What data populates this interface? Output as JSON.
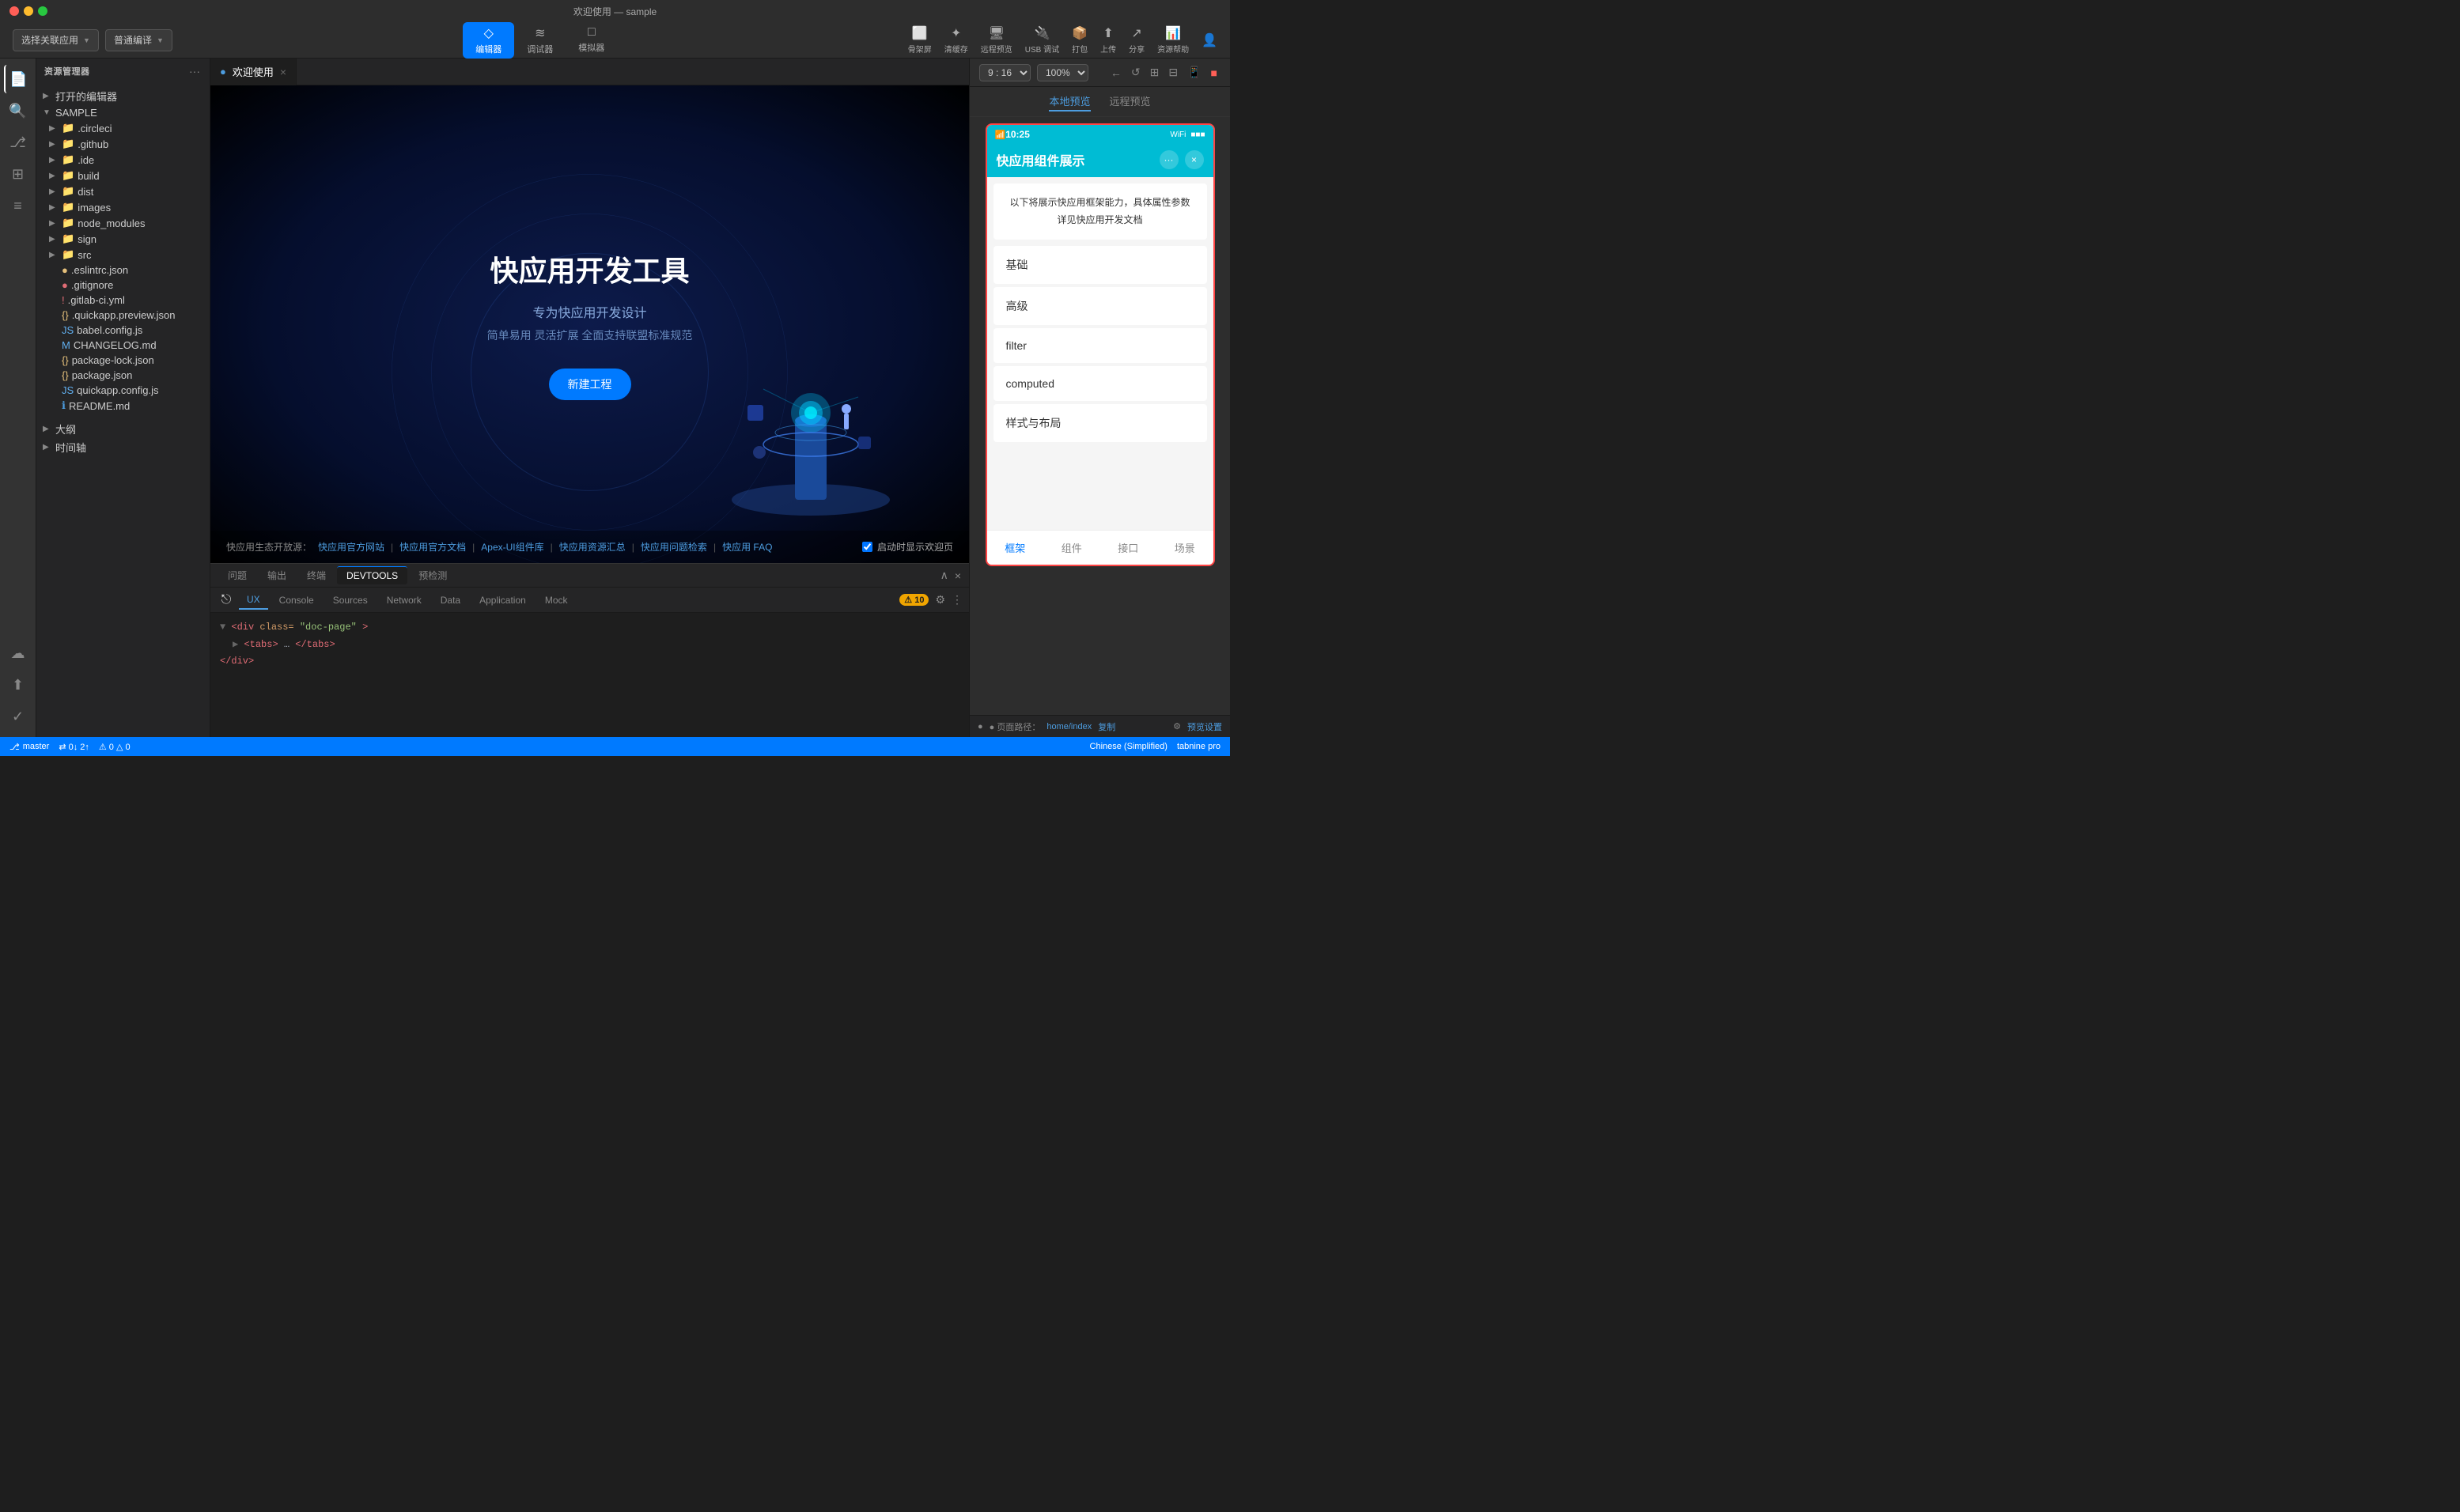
{
  "titlebar": {
    "title": "欢迎使用 — sample"
  },
  "toolbar": {
    "left": {
      "associate_app": "选择关联应用",
      "compile_mode": "普通编译"
    },
    "center": {
      "tabs": [
        {
          "id": "editor",
          "label": "编辑器",
          "icon": "◇",
          "active": true
        },
        {
          "id": "debug",
          "label": "调试器",
          "icon": "≋",
          "active": false
        },
        {
          "id": "simulator",
          "label": "模拟器",
          "icon": "□",
          "active": false
        }
      ]
    },
    "right": {
      "actions": [
        {
          "id": "skeleton",
          "label": "骨架屏",
          "icon": "⬜"
        },
        {
          "id": "clear-cache",
          "label": "清缓存",
          "icon": "✦"
        },
        {
          "id": "remote-preview",
          "label": "远程预览",
          "icon": "🖥"
        },
        {
          "id": "usb-debug",
          "label": "USB 调试",
          "icon": "🔌"
        },
        {
          "id": "package",
          "label": "打包",
          "icon": "📦"
        },
        {
          "id": "upload",
          "label": "上传",
          "icon": "⬆"
        },
        {
          "id": "share",
          "label": "分享",
          "icon": "↗"
        },
        {
          "id": "docs-help",
          "label": "资源帮助",
          "icon": "📊"
        },
        {
          "id": "account",
          "label": "账号",
          "icon": "👤"
        }
      ]
    }
  },
  "sidebar": {
    "title": "资源管理器",
    "sections": [
      {
        "label": "打开的编辑器",
        "expanded": false
      },
      {
        "label": "SAMPLE",
        "expanded": true,
        "items": [
          {
            "type": "folder",
            "name": ".circleci",
            "indent": 1,
            "expanded": false
          },
          {
            "type": "folder",
            "name": ".github",
            "indent": 1,
            "expanded": false
          },
          {
            "type": "folder",
            "name": ".ide",
            "indent": 1,
            "expanded": false
          },
          {
            "type": "folder",
            "name": "build",
            "indent": 1,
            "expanded": false
          },
          {
            "type": "folder",
            "name": "dist",
            "indent": 1,
            "expanded": false
          },
          {
            "type": "folder",
            "name": "images",
            "indent": 1,
            "expanded": false
          },
          {
            "type": "folder",
            "name": "node_modules",
            "indent": 1,
            "expanded": false
          },
          {
            "type": "folder",
            "name": "sign",
            "indent": 1,
            "expanded": false
          },
          {
            "type": "folder",
            "name": "src",
            "indent": 1,
            "expanded": false
          },
          {
            "type": "file",
            "name": ".eslintrc.json",
            "indent": 1,
            "color": "yellow",
            "dot": "●"
          },
          {
            "type": "file",
            "name": ".gitignore",
            "indent": 1,
            "color": "red",
            "dot": "●"
          },
          {
            "type": "file",
            "name": ".gitlab-ci.yml",
            "indent": 1,
            "color": "red",
            "dot": "!"
          },
          {
            "type": "file",
            "name": ".quickapp.preview.json",
            "indent": 1,
            "color": "yellow",
            "dot": "{}"
          },
          {
            "type": "file",
            "name": "babel.config.js",
            "indent": 1,
            "color": "blue",
            "dot": "JS"
          },
          {
            "type": "file",
            "name": "CHANGELOG.md",
            "indent": 1,
            "color": "blue",
            "dot": "M"
          },
          {
            "type": "file",
            "name": "package-lock.json",
            "indent": 1,
            "color": "yellow",
            "dot": "{}"
          },
          {
            "type": "file",
            "name": "package.json",
            "indent": 1,
            "color": "yellow",
            "dot": "{}"
          },
          {
            "type": "file",
            "name": "quickapp.config.js",
            "indent": 1,
            "color": "blue",
            "dot": "JS"
          },
          {
            "type": "file",
            "name": "README.md",
            "indent": 1,
            "color": "blue",
            "dot": "ℹ"
          }
        ]
      }
    ],
    "bottom": [
      {
        "label": "大纲",
        "expanded": false
      },
      {
        "label": "时间轴",
        "expanded": false
      }
    ]
  },
  "icon_bar": {
    "items": [
      {
        "id": "explorer",
        "icon": "📄",
        "active": true
      },
      {
        "id": "search",
        "icon": "🔍",
        "active": false
      },
      {
        "id": "git",
        "icon": "⎇",
        "active": false
      },
      {
        "id": "extensions",
        "icon": "⊞",
        "active": false
      },
      {
        "id": "layers",
        "icon": "≡",
        "active": false
      },
      {
        "id": "cloud",
        "icon": "☁",
        "active": false
      },
      {
        "id": "deploy",
        "icon": "⬆",
        "active": false
      },
      {
        "id": "check",
        "icon": "✓",
        "active": false
      }
    ]
  },
  "welcome": {
    "title": "快应用开发工具",
    "subtitle": "专为快应用开发设计",
    "desc": "简单易用 灵活扩展 全面支持联盟标准规范",
    "new_project_btn": "新建工程",
    "links": [
      {
        "label": "快应用生态开放源：",
        "type": "text"
      },
      {
        "label": "快应用官方网站",
        "type": "link"
      },
      {
        "label": "快应用官方文档",
        "type": "link"
      },
      {
        "label": "Apex-UI组件库",
        "type": "link"
      },
      {
        "label": "快应用资源汇总",
        "type": "link"
      },
      {
        "label": "快应用问题检索",
        "type": "link"
      },
      {
        "label": "快应用 FAQ",
        "type": "link"
      }
    ],
    "show_on_startup": "启动时显示欢迎页"
  },
  "editor_tab": {
    "label": "欢迎使用",
    "close": "×"
  },
  "panel_tabs": [
    {
      "id": "problems",
      "label": "问题"
    },
    {
      "id": "output",
      "label": "输出"
    },
    {
      "id": "terminal",
      "label": "终端"
    },
    {
      "id": "devtools",
      "label": "DEVTOOLS",
      "active": true
    },
    {
      "id": "precheck",
      "label": "预检测"
    }
  ],
  "devtools": {
    "tabs": [
      {
        "id": "ux",
        "label": "UX",
        "active": true
      },
      {
        "id": "console",
        "label": "Console"
      },
      {
        "id": "sources",
        "label": "Sources"
      },
      {
        "id": "network",
        "label": "Network"
      },
      {
        "id": "data",
        "label": "Data"
      },
      {
        "id": "application",
        "label": "Application"
      },
      {
        "id": "mock",
        "label": "Mock"
      }
    ],
    "code": [
      {
        "line": "▼ <div class=\"doc-page\">"
      },
      {
        "line": "  ▶ <tabs>…</tabs>"
      },
      {
        "line": "  </div>"
      }
    ],
    "warning_count": "⚠ 10"
  },
  "right_panel": {
    "preview_ratio": "9 : 16",
    "zoom": "100%",
    "local_remote_tabs": [
      {
        "id": "local",
        "label": "本地预览",
        "active": true
      },
      {
        "id": "remote",
        "label": "远程预览",
        "active": false
      }
    ],
    "phone": {
      "status_bar": {
        "signal": "📶",
        "time": "10:25",
        "wifi": "WiFi",
        "battery": "■■■"
      },
      "app_title": "快应用组件展示",
      "desc_line1": "以下将展示快应用框架能力，具体属性参数",
      "desc_line2": "详见快应用开发文档",
      "menu_items": [
        {
          "label": "基础"
        },
        {
          "label": "高级"
        },
        {
          "label": "filter"
        },
        {
          "label": "computed"
        },
        {
          "label": "样式与布局"
        }
      ],
      "bottom_tabs": [
        {
          "id": "framework",
          "label": "框架",
          "active": true
        },
        {
          "id": "component",
          "label": "组件",
          "active": false
        },
        {
          "id": "api",
          "label": "接口",
          "active": false
        },
        {
          "id": "scene",
          "label": "场景",
          "active": false
        }
      ]
    },
    "footer": {
      "prefix": "● 页面路径：",
      "path": "home/index",
      "copy_link": "复制",
      "settings": "预览设置"
    }
  },
  "statusbar": {
    "branch": "master",
    "sync": "⇄ 0↓ 2↑",
    "warnings": "⚠ 0 △ 0",
    "encoding": "Chinese (Simplified)",
    "plugin": "tabnine pro"
  }
}
